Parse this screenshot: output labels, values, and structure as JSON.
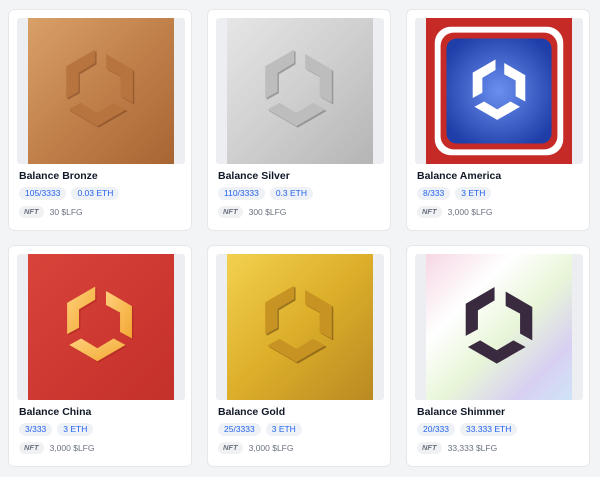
{
  "cards": [
    {
      "name": "Balance Bronze",
      "supply": "105/3333",
      "price_eth": "0.03 ETH",
      "tag": "NFT",
      "price_lfg": "30 $LFG",
      "art": "bronze"
    },
    {
      "name": "Balance Silver",
      "supply": "110/3333",
      "price_eth": "0.3 ETH",
      "tag": "NFT",
      "price_lfg": "300 $LFG",
      "art": "silver"
    },
    {
      "name": "Balance America",
      "supply": "8/333",
      "price_eth": "3 ETH",
      "tag": "NFT",
      "price_lfg": "3,000 $LFG",
      "art": "america"
    },
    {
      "name": "Balance China",
      "supply": "3/333",
      "price_eth": "3 ETH",
      "tag": "NFT",
      "price_lfg": "3,000 $LFG",
      "art": "china"
    },
    {
      "name": "Balance Gold",
      "supply": "25/3333",
      "price_eth": "3 ETH",
      "tag": "NFT",
      "price_lfg": "3,000 $LFG",
      "art": "gold"
    },
    {
      "name": "Balance Shimmer",
      "supply": "20/333",
      "price_eth": "33.333 ETH",
      "tag": "NFT",
      "price_lfg": "33,333 $LFG",
      "art": "shimmer"
    }
  ],
  "colors": {
    "accent": "#2563eb",
    "bronze": "#c98a52",
    "silver": "#c9c9c9",
    "america_red": "#c62a26",
    "america_blue": "#2d4fb8",
    "china_red": "#d23a2e",
    "gold": "#d9a92a"
  }
}
